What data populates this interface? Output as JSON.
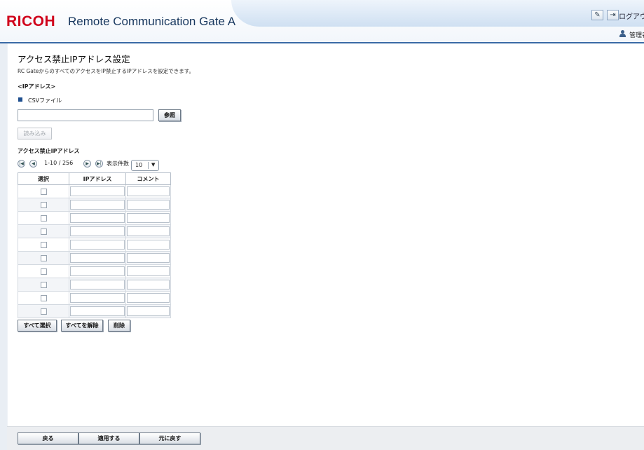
{
  "header": {
    "brand": "RICOH",
    "product": "Remote Communication Gate A",
    "logout_label": "ログアウ",
    "user_label": "管理者"
  },
  "page": {
    "title": "アクセス禁止IPアドレス設定",
    "description": "RC GateからのすべてのアクセスをIP禁止するIPアドレスを設定できます。"
  },
  "import": {
    "section_title": "<IPアドレス>",
    "csv_label": "CSVファイル",
    "file_value": "",
    "browse_label": "参照",
    "load_label": "読み込み"
  },
  "list": {
    "title": "アクセス禁止IPアドレス",
    "range": "1-10 / 256",
    "per_page_label": "表示件数",
    "per_page_value": "10",
    "columns": [
      "選択",
      "IPアドレス",
      "コメント"
    ],
    "rows": [
      {
        "ip": "",
        "comment": ""
      },
      {
        "ip": "",
        "comment": ""
      },
      {
        "ip": "",
        "comment": ""
      },
      {
        "ip": "",
        "comment": ""
      },
      {
        "ip": "",
        "comment": ""
      },
      {
        "ip": "",
        "comment": ""
      },
      {
        "ip": "",
        "comment": ""
      },
      {
        "ip": "",
        "comment": ""
      },
      {
        "ip": "",
        "comment": ""
      },
      {
        "ip": "",
        "comment": ""
      }
    ],
    "select_all_label": "すべて選択",
    "deselect_all_label": "すべてを解除",
    "delete_label": "削除"
  },
  "footer": {
    "back_label": "戻る",
    "apply_label": "適用する",
    "revert_label": "元に戻す"
  },
  "colors": {
    "brand_red": "#d0021b",
    "accent_blue": "#3a6aa6"
  }
}
